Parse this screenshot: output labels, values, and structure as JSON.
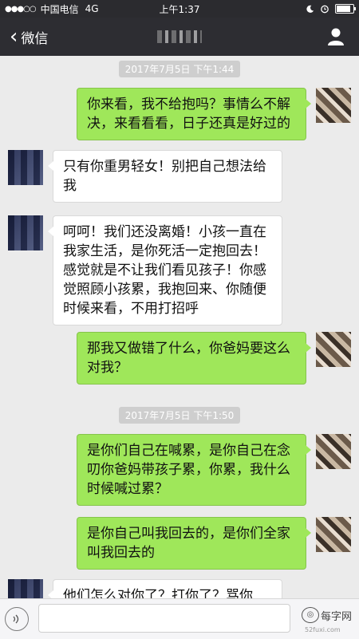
{
  "status_bar": {
    "signal": "●●●○○",
    "carrier": "中国电信",
    "network": "4G",
    "time": "上午1:37",
    "battery_level": 0.85
  },
  "nav": {
    "back_label": "微信",
    "title_icon": "blurred-contact-name",
    "profile_icon": "person-icon"
  },
  "messages": [
    {
      "type": "timestamp",
      "text": "2017年7月5日  下午1:44"
    },
    {
      "type": "bubble",
      "side": "right",
      "lines": [
        "你来看，我不给抱吗？事情么不解",
        "决，来看看看，日子还真是好过的"
      ]
    },
    {
      "type": "bubble",
      "side": "left",
      "lines": [
        "只有你重男轻女！别把自己想法给",
        "我"
      ]
    },
    {
      "type": "bubble",
      "side": "left",
      "lines": [
        "呵呵！我们还没离婚！小孩一直在",
        "我家生活，是你死活一定抱回去！",
        "感觉就是不让我们看见孩子！你感",
        "觉照顾小孩累，我抱回来、你随便",
        "时候来看，不用打招呼"
      ]
    },
    {
      "type": "bubble",
      "side": "right",
      "lines": [
        "那我又做错了什么，你爸妈要这么",
        "对我？"
      ]
    },
    {
      "type": "timestamp",
      "text": "2017年7月5日  下午1:50"
    },
    {
      "type": "bubble",
      "side": "right",
      "lines": [
        "是你们自己在喊累，是你自己在念",
        "叨你爸妈带孩子累，你累，我什么",
        "时候喊过累？"
      ]
    },
    {
      "type": "bubble",
      "side": "right",
      "lines": [
        "是你自己叫我回去的，是你们全家",
        "叫我回去的"
      ]
    },
    {
      "type": "bubble",
      "side": "left",
      "lines": [
        "他们怎么对你了？打你了？骂你"
      ]
    }
  ],
  "input_bar": {
    "voice_icon": "voice-icon",
    "watermark_text": "每字网",
    "watermark_url": "52fuxi.com"
  }
}
